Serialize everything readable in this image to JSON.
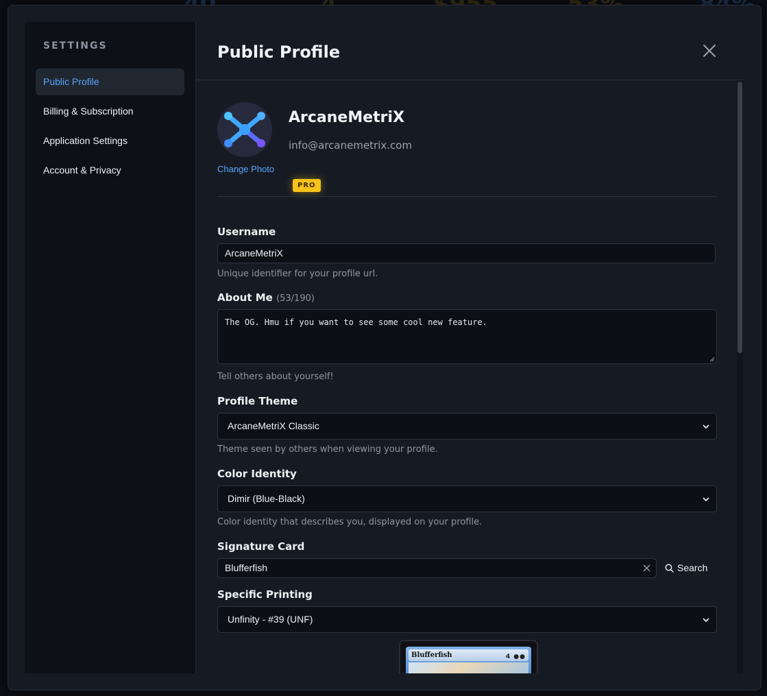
{
  "sidebar": {
    "heading": "SETTINGS",
    "items": [
      {
        "label": "Public Profile",
        "active": true
      },
      {
        "label": "Billing & Subscription",
        "active": false
      },
      {
        "label": "Application Settings",
        "active": false
      },
      {
        "label": "Account & Privacy",
        "active": false
      }
    ]
  },
  "header": {
    "title": "Public Profile",
    "close_icon": "close-icon"
  },
  "profile": {
    "display_name": "ArcaneMetriX",
    "email": "info@arcanemetrix.com",
    "badge": "PRO",
    "change_photo_label": "Change Photo"
  },
  "form": {
    "username": {
      "label": "Username",
      "value": "ArcaneMetriX",
      "help": "Unique identifier for your profile url."
    },
    "about": {
      "label": "About Me",
      "counter": "(53/190)",
      "value": "The OG. Hmu if you want to see some cool new feature.",
      "help": "Tell others about yourself!"
    },
    "theme": {
      "label": "Profile Theme",
      "value": "ArcaneMetriX Classic",
      "help": "Theme seen by others when viewing your profile."
    },
    "color_identity": {
      "label": "Color Identity",
      "value": "Dimir (Blue-Black)",
      "help": "Color identity that describes you, displayed on your profile."
    },
    "signature_card": {
      "label": "Signature Card",
      "value": "Blufferfish",
      "search_label": "Search"
    },
    "printing": {
      "label": "Specific Printing",
      "value": "Unfinity - #39 (UNF)"
    }
  },
  "card_preview": {
    "name": "Blufferfish",
    "mana": "4"
  },
  "colors": {
    "accent": "#5aa4ff",
    "badge": "#f7c21a",
    "panel": "#161b23",
    "sidebar": "#0d1117"
  }
}
